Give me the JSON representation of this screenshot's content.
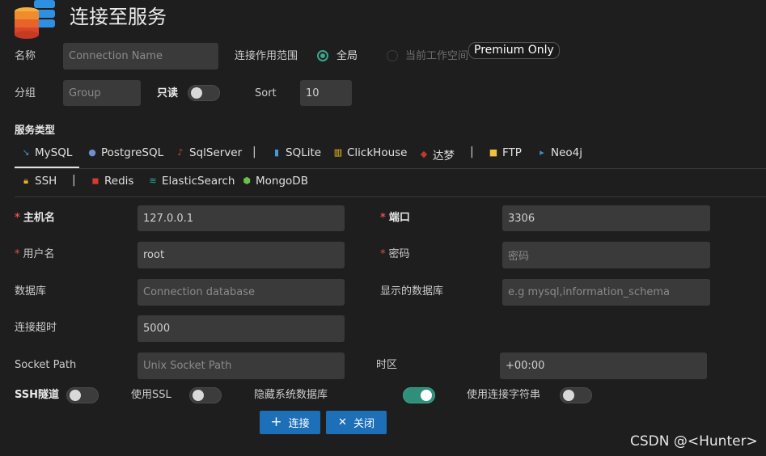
{
  "header": {
    "title": "连接至服务"
  },
  "row1": {
    "name_label": "名称",
    "name_placeholder": "Connection Name",
    "scope_label": "连接作用范围",
    "scope_global": "全局",
    "scope_workspace": "当前工作空间",
    "premium_badge": "Premium Only"
  },
  "row2": {
    "group_label": "分组",
    "group_placeholder": "Group",
    "readonly_label": "只读",
    "sort_label": "Sort",
    "sort_value": "10"
  },
  "service": {
    "label": "服务类型",
    "tabs_row1": [
      "MySQL",
      "PostgreSQL",
      "SqlServer",
      "SQLite",
      "ClickHouse",
      "达梦",
      "FTP",
      "Neo4j"
    ],
    "tabs_row2": [
      "SSH",
      "Redis",
      "ElasticSearch",
      "MongoDB"
    ],
    "separator": "|"
  },
  "form": {
    "host_label": "主机名",
    "host_value": "127.0.0.1",
    "port_label": "端口",
    "port_value": "3306",
    "user_label": "用户名",
    "user_value": "root",
    "password_label": "密码",
    "password_placeholder": "密码",
    "database_label": "数据库",
    "database_placeholder": "Connection database",
    "show_db_label": "显示的数据库",
    "show_db_placeholder": "e.g mysql,information_schema",
    "timeout_label": "连接超时",
    "timeout_value": "5000",
    "socket_label": "Socket Path",
    "socket_placeholder": "Unix Socket Path",
    "timezone_label": "时区",
    "timezone_value": "+00:00",
    "required_mark": "*"
  },
  "options": {
    "ssh_label": "SSH隧道",
    "ssh_on": false,
    "ssl_label": "使用SSL",
    "ssl_on": false,
    "hide_sys_label": "隐藏系统数据库",
    "hide_sys_on": true,
    "conn_string_label": "使用连接字符串",
    "conn_string_on": false
  },
  "buttons": {
    "connect": "连接",
    "close": "关闭"
  },
  "watermark": "CSDN @<Hunter>",
  "colors": {
    "accent": "#1d6fb8",
    "toggle_on": "#2f8f78",
    "active_tab": "#e0e0e0"
  }
}
